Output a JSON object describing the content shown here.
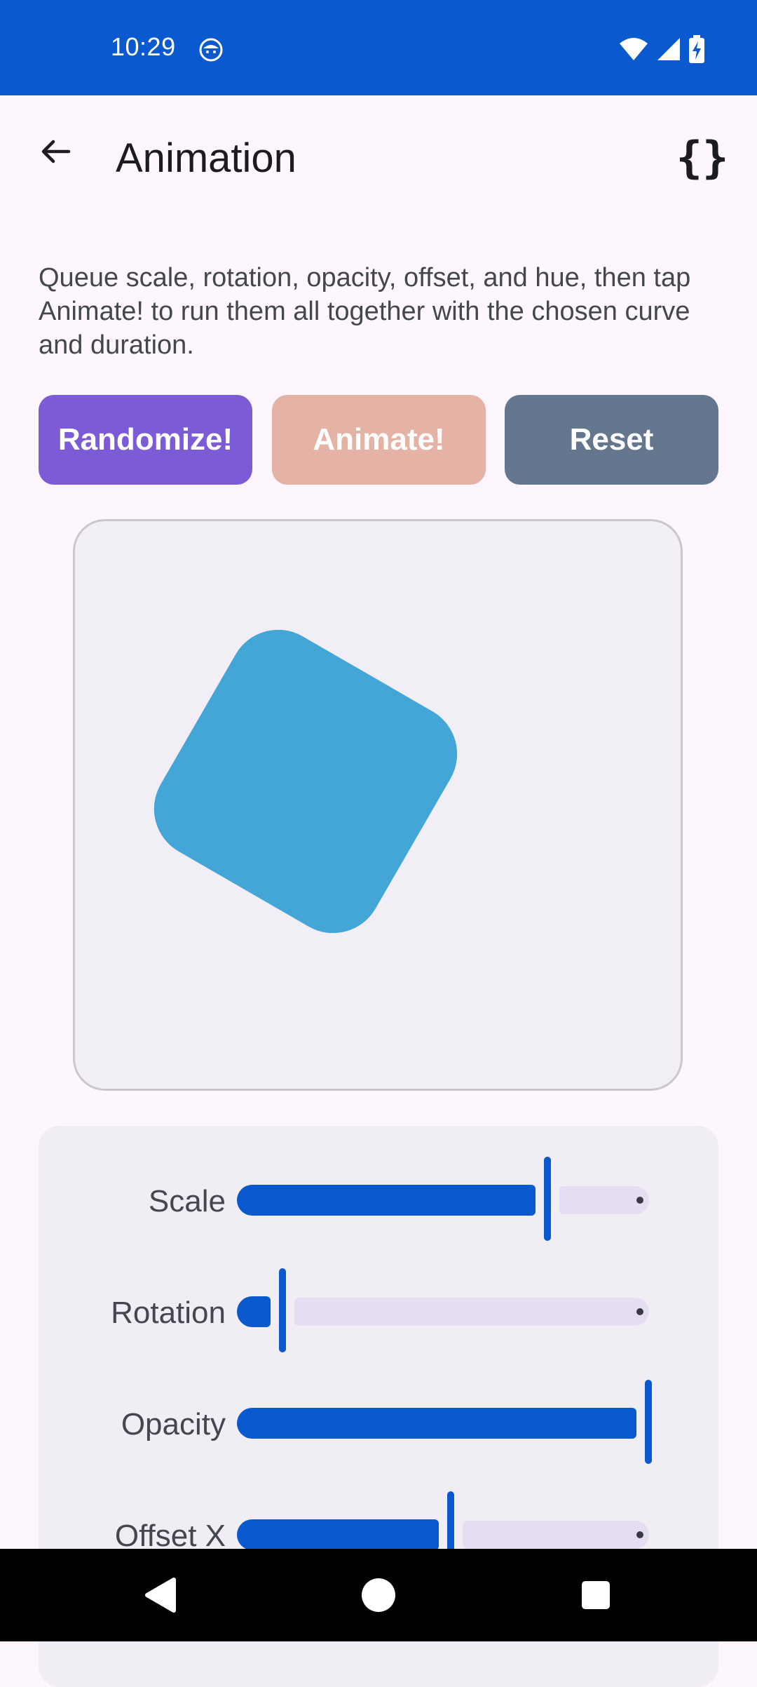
{
  "status_bar": {
    "time": "10:29",
    "background": "#0b59cf"
  },
  "app_bar": {
    "title": "Animation",
    "back_icon": "arrow-back-icon",
    "code_icon": "code-braces-icon",
    "code_label": "{}"
  },
  "description": "Queue scale, rotation, opacity, offset, and hue, then tap Animate! to run them all together with the chosen curve and duration.",
  "buttons": {
    "randomize": "Randomize!",
    "animate": "Animate!",
    "reset": "Reset"
  },
  "colors": {
    "randomize": "#7b5bd6",
    "animate": "#e5b3a6",
    "reset": "#65778e",
    "shape": "#43a6d6",
    "slider_active": "#0b59cf",
    "slider_track": "#e5def3"
  },
  "preview": {
    "shape_rotation_deg": 30
  },
  "controls": {
    "sliders": [
      {
        "label": "Scale",
        "value": 0.73
      },
      {
        "label": "Rotation",
        "value": 0.1
      },
      {
        "label": "Opacity",
        "value": 0.97
      },
      {
        "label": "Offset X",
        "value": 0.5
      }
    ]
  }
}
